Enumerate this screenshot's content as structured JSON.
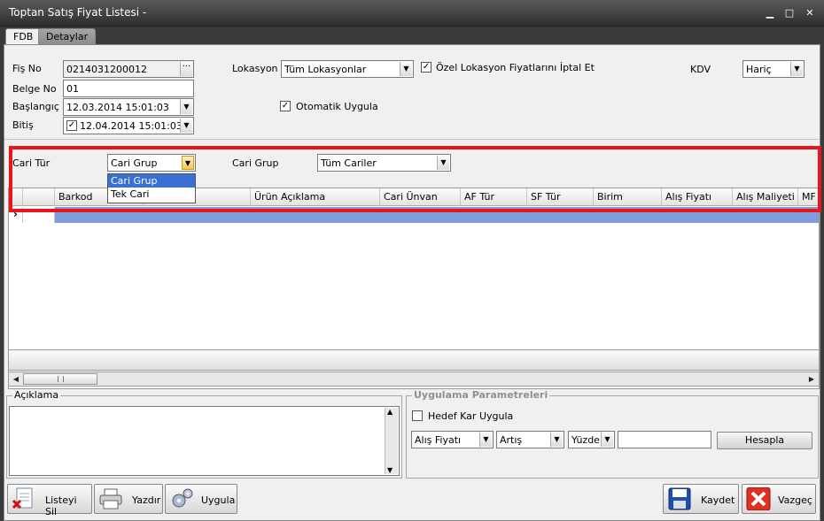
{
  "window": {
    "title": "Toptan Satış Fiyat Listesi -",
    "minimize_glyph": "▁",
    "maximize_glyph": "□",
    "close_glyph": "✕"
  },
  "tabs": [
    {
      "label": "FDB",
      "active": true
    },
    {
      "label": "Detaylar",
      "active": false
    }
  ],
  "form": {
    "fis_no": {
      "label": "Fiş No",
      "value": "0214031200012",
      "button": "···"
    },
    "belge_no": {
      "label": "Belge No",
      "value": "01"
    },
    "baslangic": {
      "label": "Başlangıç",
      "value": "12.03.2014 15:01:03"
    },
    "bitis": {
      "label": "Bitiş",
      "value": "12.04.2014 15:01:03",
      "checked": true
    },
    "lokasyon": {
      "label": "Lokasyon",
      "value": "Tüm Lokasyonlar"
    },
    "ozel_lokasyon": {
      "label": "Özel Lokasyon Fiyatlarını İptal Et",
      "checked": true
    },
    "otomatik": {
      "label": "Otomatik Uygula",
      "checked": true
    },
    "kdv": {
      "label": "KDV",
      "value": "Hariç"
    }
  },
  "filter": {
    "cari_tur": {
      "label": "Cari Tür",
      "value": "Cari Grup",
      "options": [
        "Cari Grup",
        "Tek Cari"
      ],
      "selected_index": 0
    },
    "cari_grup": {
      "label": "Cari Grup",
      "value": "Tüm Cariler"
    }
  },
  "grid": {
    "columns": [
      "Barkod",
      "",
      "Ürün Açıklama",
      "Cari Ünvan",
      "AF Tür",
      "SF Tür",
      "Birim",
      "Alış Fiyatı",
      "Alış Maliyeti",
      "MF I"
    ],
    "row_indicator": "›"
  },
  "aciklama": {
    "label": "Açıklama"
  },
  "uygulama": {
    "label": "Uygulama Parametreleri",
    "hedef_kar": {
      "label": "Hedef Kar Uygula",
      "checked": false
    },
    "price_select": "Alış Fiyatı",
    "op_select": "Artış",
    "unit_select": "Yüzde",
    "value": "",
    "hesapla": "Hesapla"
  },
  "buttons": {
    "listeyi_sil": "Listeyi Sil",
    "yazdir": "Yazdır",
    "uygula": "Uygula",
    "kaydet": "Kaydet",
    "vazgec": "Vazgeç"
  },
  "colors": {
    "highlight_red": "#e8161a",
    "selected_row": "#7f9ddb",
    "dropdown_selected": "#3a6fd3"
  }
}
